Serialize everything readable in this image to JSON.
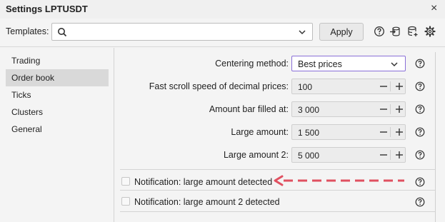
{
  "window": {
    "title": "Settings LPTUSDT",
    "close": "×"
  },
  "toolbar": {
    "templates_label": "Templates:",
    "templates_value": "",
    "apply_label": "Apply"
  },
  "sidebar": {
    "items": [
      {
        "label": "Trading",
        "active": false
      },
      {
        "label": "Order book",
        "active": true
      },
      {
        "label": "Ticks",
        "active": false
      },
      {
        "label": "Clusters",
        "active": false
      },
      {
        "label": "General",
        "active": false
      }
    ]
  },
  "settings": {
    "centering": {
      "label": "Centering method:",
      "value": "Best prices"
    },
    "fast_scroll": {
      "label": "Fast scroll speed of decimal prices:",
      "value": "100"
    },
    "amount_bar": {
      "label": "Amount bar filled at:",
      "value": "3 000"
    },
    "large_amount": {
      "label": "Large amount:",
      "value": "1 500"
    },
    "large_amount_2": {
      "label": "Large amount 2:",
      "value": "5 000"
    }
  },
  "notifications": {
    "large": {
      "label": "Notification: large amount detected",
      "checked": false
    },
    "large_2": {
      "label": "Notification: large amount 2 detected",
      "checked": false
    }
  },
  "colors": {
    "accent_border": "#8a6fd8",
    "annotation_arrow": "#e05060"
  }
}
